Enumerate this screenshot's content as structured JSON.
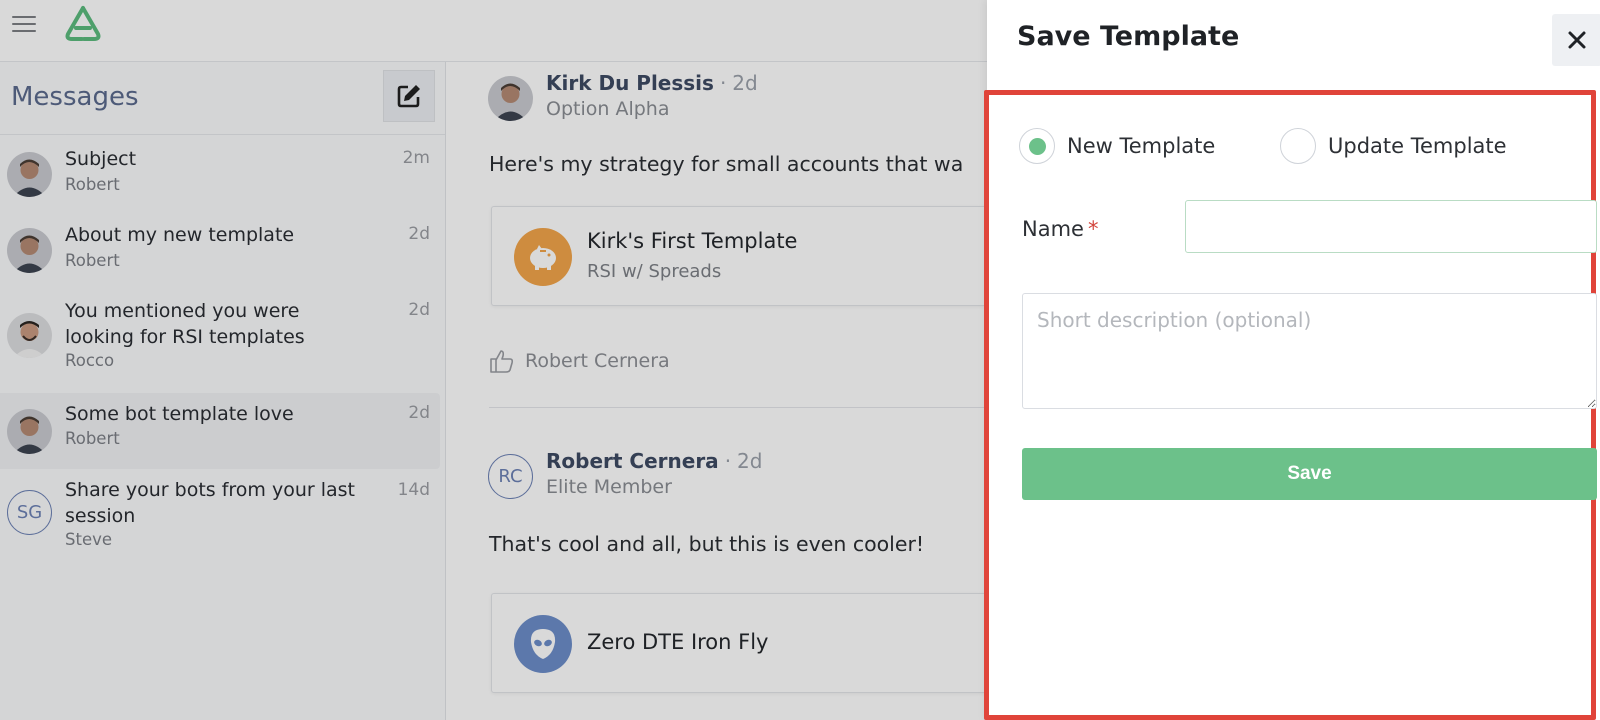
{
  "header": {
    "menu_icon": "hamburger-icon",
    "logo_icon": "app-logo-icon"
  },
  "sidebar": {
    "title": "Messages",
    "compose_icon": "compose-icon",
    "conversations": [
      {
        "subject": "Subject",
        "sender": "Robert",
        "time": "2m",
        "avatar": "photo"
      },
      {
        "subject": "About my new template",
        "sender": "Robert",
        "time": "2d",
        "avatar": "photo"
      },
      {
        "subject": "You mentioned you were looking for RSI templates",
        "sender": "Rocco",
        "time": "2d",
        "avatar": "photo"
      },
      {
        "subject": "Some bot template love",
        "sender": "Robert",
        "time": "2d",
        "avatar": "photo",
        "active": true
      },
      {
        "subject": "Share your bots from your last session",
        "sender": "Steve",
        "time": "14d",
        "avatar_initials": "SG"
      }
    ]
  },
  "thread": {
    "messages": [
      {
        "author": "Kirk Du Plessis",
        "age": "2d",
        "role": "Option Alpha",
        "text": "Here's my strategy for small accounts that wa",
        "template": {
          "name": "Kirk's First Template",
          "subtitle": "RSI w/ Spreads",
          "icon": "piggy-bank-icon",
          "color": "#f2a54a"
        },
        "likes": [
          "Robert Cernera"
        ]
      },
      {
        "author": "Robert Cernera",
        "age": "2d",
        "role": "Elite Member",
        "avatar_initials": "RC",
        "text": "That's cool and all, but this is even cooler!",
        "template": {
          "name": "Zero DTE Iron Fly",
          "subtitle": "",
          "icon": "alien-icon",
          "color": "#6d8ec9"
        }
      }
    ]
  },
  "save_panel": {
    "title": "Save Template",
    "close_icon": "close-icon",
    "options": {
      "new": "New Template",
      "update": "Update Template",
      "selected": "new"
    },
    "name_label": "Name",
    "required_mark": "*",
    "name_value": "",
    "description_placeholder": "Short description (optional)",
    "save_label": "Save"
  },
  "colors": {
    "accent_green": "#6cc18a",
    "highlight_red": "#e0443a",
    "title_blue": "#5b6a8d",
    "orange": "#f2a54a",
    "blue": "#6d8ec9"
  }
}
